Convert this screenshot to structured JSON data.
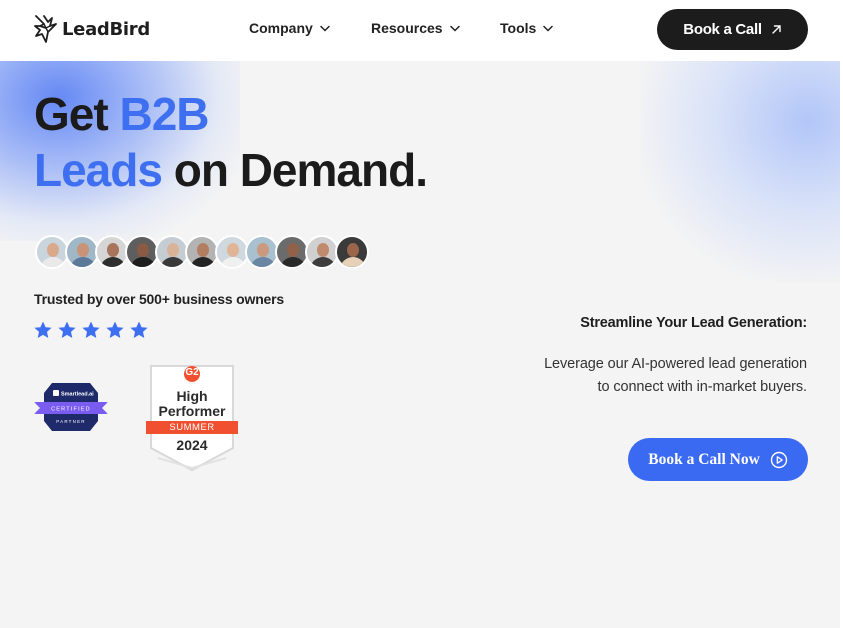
{
  "header": {
    "logo_text": "LeadBird",
    "logo_icon": "bird-logo-icon",
    "nav": [
      {
        "label": "Company",
        "icon": "chevron-down-icon"
      },
      {
        "label": "Resources",
        "icon": "chevron-down-icon"
      },
      {
        "label": "Tools",
        "icon": "chevron-down-icon"
      }
    ],
    "cta_label": "Book a Call",
    "cta_icon": "arrow-up-right-icon"
  },
  "hero": {
    "headline": {
      "part1": "Get ",
      "part2_highlight": "B2B",
      "part3_highlight": "Leads",
      "part4": " on Demand."
    },
    "avatars_count": 11,
    "trusted_text": "Trusted by over 500+ business owners",
    "rating_stars": 5,
    "badges": {
      "smartlead": {
        "brand": "Smartlead.ai",
        "line1": "CERTIFIED",
        "line2": "PARTNER"
      },
      "g2": {
        "logo": "G2",
        "line1": "High",
        "line2": "Performer",
        "ribbon": "SUMMER",
        "year": "2024"
      }
    },
    "streamline_title": "Streamline Your Lead Generation:",
    "description": "Leverage our AI-powered lead generation to connect with in-market buyers.",
    "cta_label": "Book a Call Now",
    "cta_icon": "play-circle-icon"
  },
  "colors": {
    "accent": "#3d6ff0",
    "dark_button": "#1c1c1c",
    "hero_bg": "#f4f4f4",
    "star": "#3d6ff0",
    "g2_red": "#f0502f",
    "smartlead_navy": "#1f2a6b",
    "smartlead_purple": "#7b5cf0"
  }
}
